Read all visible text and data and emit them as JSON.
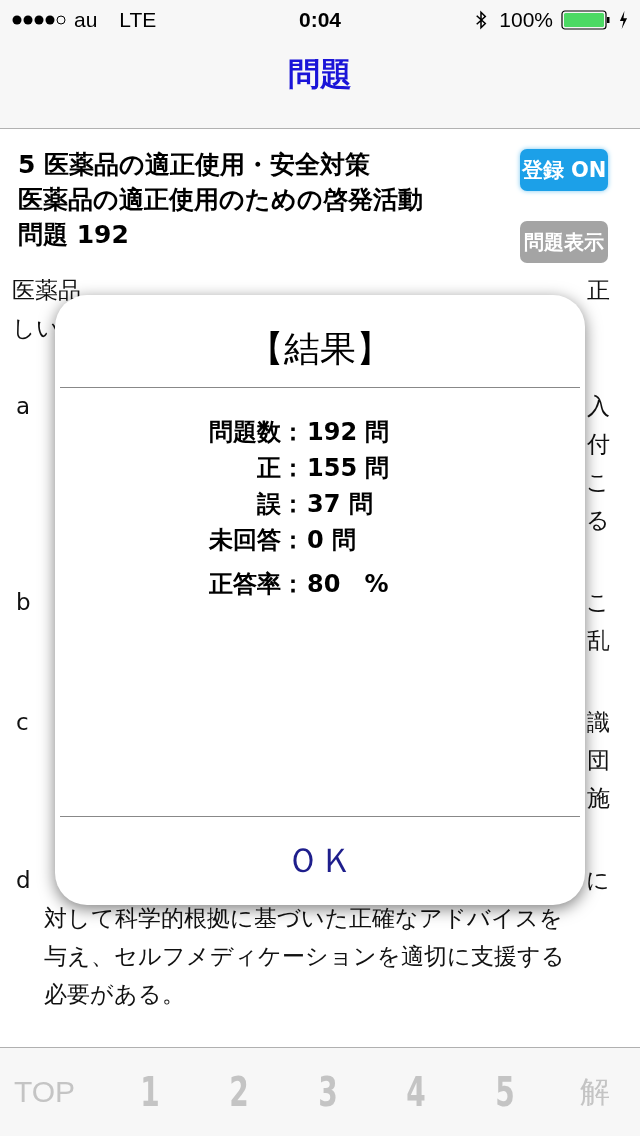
{
  "status_bar": {
    "carrier": "au",
    "network": "LTE",
    "time": "0:04",
    "battery": "100%"
  },
  "nav_bar": {
    "title": "問題"
  },
  "header": {
    "lines": [
      "5 医薬品の適正使用・安全対策",
      "医薬品の適正使用のための啓発活動",
      "問題 192"
    ],
    "register_button": {
      "label": "登録 ON",
      "on": true
    },
    "show_button": {
      "label": "問題表示"
    }
  },
  "question": [
    {
      "lines": [
        {
          "left": "医薬品",
          "right": "正"
        },
        {
          "left": "しい"
        }
      ]
    },
    {
      "marker": "a",
      "lines": [
        {
          "right": "入"
        },
        {
          "right": "付"
        },
        {
          "right": "こ"
        },
        {
          "right": "る"
        }
      ]
    },
    {
      "marker": "b",
      "lines": [
        {
          "right": "こ"
        },
        {
          "right": "乱"
        }
      ]
    },
    {
      "marker": "c",
      "lines": [
        {
          "right": "識"
        },
        {
          "right": "団"
        },
        {
          "right": "施"
        }
      ]
    },
    {
      "marker": "d",
      "lines": [
        {
          "right": "に"
        },
        {
          "full": "対して科学的根拠に基づいた正確なアドバイスを"
        },
        {
          "full": "与え、セルフメディケーションを適切に支援する"
        },
        {
          "full": "必要がある。"
        }
      ]
    }
  ],
  "result_dialog": {
    "title": "【結果】",
    "stats": [
      {
        "label": "問題数：",
        "value": "192 問"
      },
      {
        "label": "正：",
        "value": "155 問"
      },
      {
        "label": "誤：",
        "value": "37 問"
      },
      {
        "label": "未回答：",
        "value": "0 問"
      }
    ],
    "rate": {
      "label": "正答率：",
      "value": "80　%"
    },
    "ok_button": "ＯＫ"
  },
  "tab_bar": [
    {
      "label": "TOP",
      "kind": "text"
    },
    {
      "label": "1",
      "kind": "number"
    },
    {
      "label": "2",
      "kind": "number"
    },
    {
      "label": "3",
      "kind": "number"
    },
    {
      "label": "4",
      "kind": "number"
    },
    {
      "label": "5",
      "kind": "number"
    },
    {
      "label": "解",
      "kind": "text"
    }
  ]
}
